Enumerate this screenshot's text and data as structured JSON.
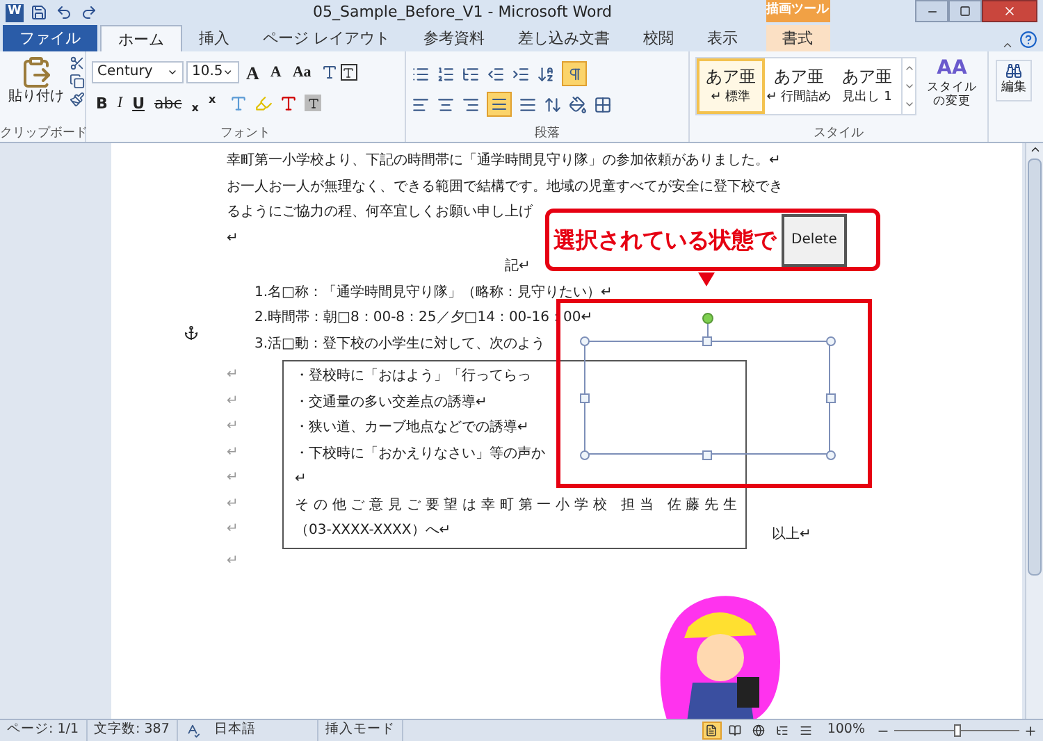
{
  "title_bar": {
    "app_icon": "W",
    "title": "05_Sample_Before_V1 - Microsoft Word"
  },
  "contextual_header": "描画ツール",
  "tabs": [
    {
      "label": "ファイル",
      "kind": "file",
      "selected": false
    },
    {
      "label": "ホーム",
      "kind": "tab",
      "selected": true
    },
    {
      "label": "挿入",
      "kind": "tab",
      "selected": false
    },
    {
      "label": "ページ レイアウト",
      "kind": "tab",
      "selected": false
    },
    {
      "label": "参考資料",
      "kind": "tab",
      "selected": false
    },
    {
      "label": "差し込み文書",
      "kind": "tab",
      "selected": false
    },
    {
      "label": "校閲",
      "kind": "tab",
      "selected": false
    },
    {
      "label": "表示",
      "kind": "tab",
      "selected": false
    },
    {
      "label": "書式",
      "kind": "contextual",
      "selected": false
    }
  ],
  "ribbon": {
    "clipboard": {
      "paste": "貼り付け",
      "label": "クリップボード"
    },
    "font": {
      "name": "Century",
      "size": "10.5",
      "label": "フォント",
      "row1": [
        {
          "text": "A",
          "kind": "grow"
        },
        {
          "text": "A",
          "kind": "shrink"
        },
        {
          "text": "Aa",
          "kind": "case"
        }
      ],
      "row2": [
        {
          "text": "B",
          "kind": "bold"
        },
        {
          "text": "I",
          "kind": "italic"
        },
        {
          "text": "U",
          "kind": "underline"
        },
        {
          "text": "abc",
          "kind": "strike"
        },
        {
          "text": "x",
          "kind": "sub"
        },
        {
          "text": "x",
          "kind": "sup"
        }
      ]
    },
    "paragraph": {
      "label": "段落"
    },
    "styles": {
      "label": "スタイル",
      "items": [
        {
          "sample": "あア亜",
          "name": "↵ 標準",
          "selected": true
        },
        {
          "sample": "あア亜",
          "name": "↵ 行間詰め",
          "selected": false
        },
        {
          "sample": "あア亜",
          "name": "見出し 1",
          "selected": false
        }
      ],
      "change_icon": "AA",
      "change": "スタイルの変更"
    },
    "editing": {
      "label": "編集"
    }
  },
  "document": {
    "paragraphs": [
      "幸町第一小学校より、下記の時間帯に「通学時間見守り隊」の参加依頼がありました。↵",
      "お一人お一人が無理なく、できる範囲で結構です。地域の児童すべてが安全に登下校でき",
      "るようにご協力の程、何卒宜しくお願い申し上げ",
      "↵"
    ],
    "heading": "記↵",
    "items": [
      "1.名□称：「通学時間見守り隊」（略称：見守りたい）↵",
      "2.時間帯：朝□8：00-8：25／夕□14：00-16：00↵",
      "3.活□動：登下校の小学生に対して、次のよう"
    ],
    "box_lines": [
      {
        "mark": "↵",
        "text": "・登校時に「おはよう」「行ってらっ"
      },
      {
        "mark": "↵",
        "text": "・交通量の多い交差点の誘導↵"
      },
      {
        "mark": "↵",
        "text": "・狭い道、カーブ地点などでの誘導↵"
      },
      {
        "mark": "↵",
        "text": "・下校時に「おかえりなさい」等の声か"
      },
      {
        "mark": "↵",
        "text": "↵"
      },
      {
        "mark": "↵",
        "text": "その他ご意見ご要望は幸町第一小学校 担当 佐藤先生"
      },
      {
        "mark": "↵",
        "text": "（03-XXXX-XXXX）へ↵"
      }
    ],
    "closing": "以上↵",
    "trailing": "↵"
  },
  "callout": {
    "text": "選択されている状態で",
    "key": "Delete"
  },
  "status_bar": {
    "page": "ページ: 1/1",
    "words": "文字数: 387",
    "language": "日本語",
    "mode": "挿入モード",
    "views": [
      {
        "selected": true
      },
      {
        "selected": false
      },
      {
        "selected": false
      },
      {
        "selected": false
      },
      {
        "selected": false
      }
    ],
    "zoom": "100%",
    "zoom_level": {
      "level": 0.5
    }
  }
}
